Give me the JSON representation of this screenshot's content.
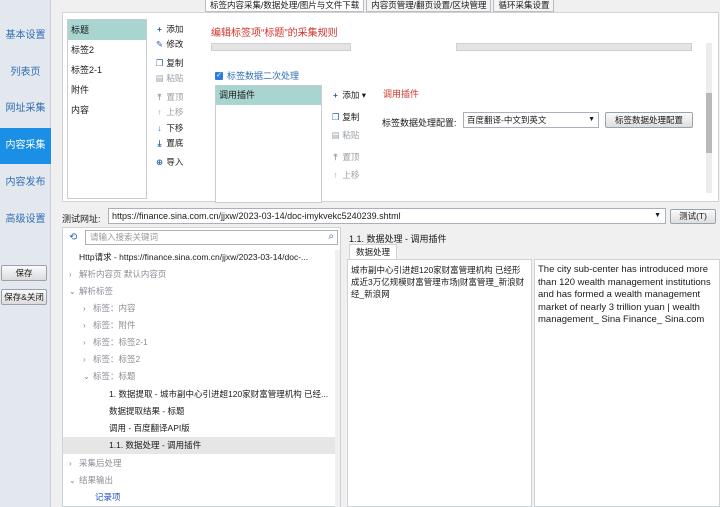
{
  "nav": {
    "items": [
      "基本设置",
      "列表页",
      "网址采集",
      "内容采集",
      "内容发布",
      "高级设置"
    ],
    "active": "内容采集",
    "save": "保存",
    "save_close": "保存&关闭"
  },
  "tabs": [
    "标签内容采集/数据处理/图片与文件下载",
    "内容页管理/翻页设置/区块管理",
    "循环采集设置"
  ],
  "tags": [
    "标题",
    "标签2",
    "标签2-1",
    "附件",
    "内容"
  ],
  "tag_tools": {
    "add": "添加",
    "edit": "修改",
    "copy": "复制",
    "paste": "粘贴",
    "top": "置顶",
    "up": "上移",
    "down": "下移",
    "bottom": "置底",
    "import": "导入"
  },
  "rule_title": "编辑标签项“标题”的采集规则",
  "secondary": {
    "checkbox": "标签数据二次处理",
    "plugin_item": "调用插件",
    "add": "添加",
    "copy": "复制",
    "paste": "粘贴",
    "top": "置顶",
    "up": "上移",
    "heading": "调用插件",
    "config_label": "标签数据处理配置:",
    "select_value": "百度翻译-中文到英文",
    "config_button": "标签数据处理配置"
  },
  "test": {
    "label": "测试网址:",
    "url": "https://finance.sina.com.cn/jjxw/2023-03-14/doc-imykvekc5240239.shtml",
    "button": "测试(T)"
  },
  "tree": {
    "search_placeholder": "请输入搜索关键词",
    "rows": [
      "Http请求 - https://finance.sina.com.cn/jjxw/2023-03-14/doc-...",
      "解析内容页 默认内容页",
      "解析标签",
      "标签：内容",
      "标签：附件",
      "标签：标签2-1",
      "标签：标签2",
      "标签：标题",
      "1. 数据提取 - 城市副中心引进超120家财富管理机构 已经...",
      "数据提取结果 - 标题",
      "调用 - 百度翻译API版",
      "1.1. 数据处理 - 调用插件",
      "采集后处理",
      "结果输出",
      "记录项"
    ]
  },
  "result": {
    "title": "1.1. 数据处理 - 调用插件",
    "tab": "数据处理",
    "left_text": "城市副中心引进超120家财富管理机构 已经形成近3万亿规模财富管理市场|财富管理_新浪财经_新浪网",
    "right_text": "The city sub-center has introduced more than 120 wealth management institutions and has formed a wealth management market of nearly 3 trillion yuan | wealth management_ Sina Finance_ Sina.com"
  }
}
